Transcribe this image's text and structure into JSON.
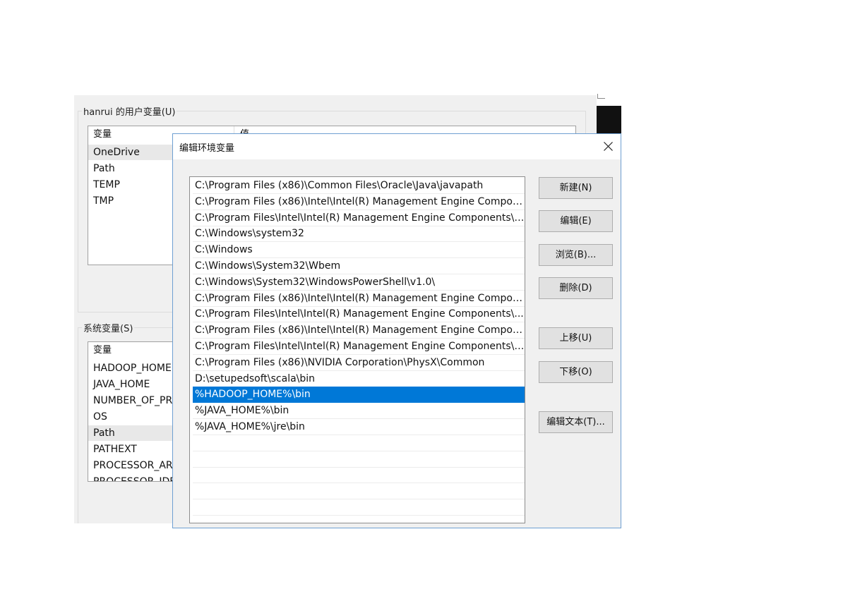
{
  "background_window": {
    "user_vars_title": "hanrui 的用户变量(U)",
    "user_vars_columns": [
      "变量",
      "值"
    ],
    "user_vars": [
      "OneDrive",
      "Path",
      "TEMP",
      "TMP"
    ],
    "system_vars_title": "系统变量(S)",
    "system_vars_column": "变量",
    "system_vars": [
      "HADOOP_HOME",
      "JAVA_HOME",
      "NUMBER_OF_PR",
      "OS",
      "Path",
      "PATHEXT",
      "PROCESSOR_AR",
      "PROCESSOR_IDE"
    ]
  },
  "dialog": {
    "title": "编辑环境变量",
    "close_icon": "close-icon",
    "paths": [
      "C:\\Program Files (x86)\\Common Files\\Oracle\\Java\\javapath",
      "C:\\Program Files (x86)\\Intel\\Intel(R) Management Engine Compon...",
      "C:\\Program Files\\Intel\\Intel(R) Management Engine Components\\i...",
      "C:\\Windows\\system32",
      "C:\\Windows",
      "C:\\Windows\\System32\\Wbem",
      "C:\\Windows\\System32\\WindowsPowerShell\\v1.0\\",
      "C:\\Program Files (x86)\\Intel\\Intel(R) Management Engine Compon...",
      "C:\\Program Files\\Intel\\Intel(R) Management Engine Components\\...",
      "C:\\Program Files (x86)\\Intel\\Intel(R) Management Engine Compon...",
      "C:\\Program Files\\Intel\\Intel(R) Management Engine Components\\I...",
      "C:\\Program Files (x86)\\NVIDIA Corporation\\PhysX\\Common",
      "D:\\setupedsoft\\scala\\bin",
      "%HADOOP_HOME%\\bin",
      "%JAVA_HOME%\\bin",
      "%JAVA_HOME%\\jre\\bin"
    ],
    "selected_path": "%HADOOP_HOME%\\bin",
    "buttons": {
      "new": "新建(N)",
      "edit": "编辑(E)",
      "browse": "浏览(B)...",
      "delete": "删除(D)",
      "move_up": "上移(U)",
      "move_down": "下移(O)",
      "edit_text": "编辑文本(T)..."
    },
    "colors": {
      "selection": "#0078d7",
      "border": "#6e9fd2"
    }
  }
}
